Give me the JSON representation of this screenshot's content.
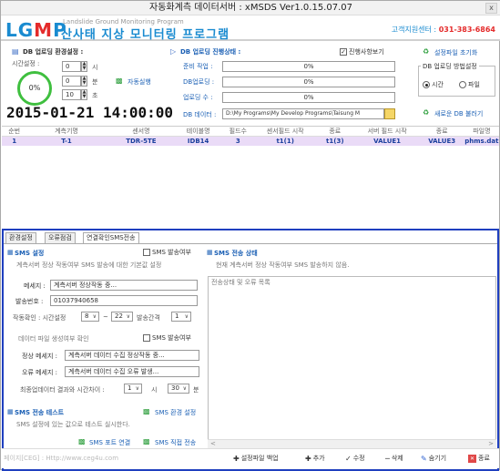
{
  "window": {
    "title": "자동화계측 데이터서버 : xMSDS Ver1.0.15.07.07",
    "close": "x"
  },
  "header": {
    "logo_prefix": "LG",
    "logo_accent": "M",
    "logo_suffix": "P",
    "logo_sub": "Landslide  Ground   Monitoring  Program",
    "logo_kor": "산사태 지상 모니터링 프로그램",
    "support_label": "고객지원센터 : ",
    "support_phone": "031-383-6864"
  },
  "env": {
    "title": "DB 업로딩 환경설정 :",
    "interval_label": "시간설정 :",
    "hour_value": "0",
    "hour_unit": "시",
    "minute_value": "0",
    "minute_unit": "분",
    "second_value": "10",
    "second_unit": "초",
    "progress": "0%",
    "auto_run": "자동실행",
    "datetime": "2015-01-21  14:00:00"
  },
  "status": {
    "title": "DB 업로딩 진행상태 :",
    "prepare_label": "준비 작업 :",
    "prepare_value": "0%",
    "db_upload_label": "DB업로딩 :",
    "db_upload_value": "0%",
    "upload_count_label": "업로딩 수 :",
    "upload_count_value": "0%",
    "db_data_label": "DB 데이터 :",
    "db_data_path": "D:\\My Programs\\My Develop Programs\\Taisung M",
    "show_progress": "진행사항보기"
  },
  "right": {
    "reset": "설정파일 초기화",
    "method_title": "DB 업로딩 방법설정",
    "method_time": "시간",
    "method_file": "파일",
    "reload": "새로운 DB 불러기"
  },
  "grid": {
    "headers": [
      "순번",
      "계측기명",
      "센서명",
      "테이블명",
      "필드수",
      "센서필드 시작",
      "종료",
      "서버 필드 시작",
      "종료",
      "파일명"
    ],
    "rows": [
      [
        "1",
        "T-1",
        "TDR-5TE",
        "IDB14",
        "3",
        "t1(1)",
        "t1(3)",
        "VALUE1",
        "VALUE3",
        "phms.dat"
      ]
    ]
  },
  "tabs": [
    "환경설정",
    "오류점검",
    "연결확인SMS전송"
  ],
  "sms": {
    "title": "SMS 설정",
    "send_flag": "SMS 발송여부",
    "desc": "계측서버 정상 작동여부 SMS 발송에 대한 기본값 설정",
    "message_label": "메세지 :",
    "message_value": "계측서버 정상작동 중...",
    "number_label": "발송번호 :",
    "number_value": "01037940658",
    "confirm_label": "작동확인 : 시간설정",
    "from_hour": "8",
    "tilde": "~",
    "to_hour": "22",
    "interval_label": "발송간격",
    "interval_value": "1",
    "data_check": "데이터 파일 생성여부 확인",
    "data_send_flag": "SMS 발송여부",
    "normal_label": "정상 메세지 :",
    "normal_value": "계측서버 데이터 수집 정상작동 중...",
    "error_label": "오류 메세지 :",
    "error_value": "계측서버 데이터 수집 오류 발생...",
    "latest_label": "최종업데이터 결과와 시간차이 :",
    "latest_hour": "1",
    "hour_unit": "시",
    "latest_minute": "30",
    "minute_unit": "분"
  },
  "sms_status": {
    "title": "SMS 전송 상태",
    "desc": "현재 계측서버 정상 작동여부 SMS 발송하지 않음.",
    "log_header": "전송상태 및 오류 목록"
  },
  "sms_test": {
    "title": "SMS 전송 테스트",
    "env_button": "SMS 환경 설정",
    "desc": "SMS 설정에 있는 값으로 테스트 실시한다.",
    "port_button": "SMS 포트 연결",
    "send_button": "SMS 직접 전송"
  },
  "footer": {
    "homepage": "페이지[CEG] : Http://www.ceg4u.com",
    "backup": "설정파일 백업",
    "add": "추가",
    "edit": "수정",
    "delete": "삭제",
    "hide": "숨기기",
    "exit": "종료"
  }
}
